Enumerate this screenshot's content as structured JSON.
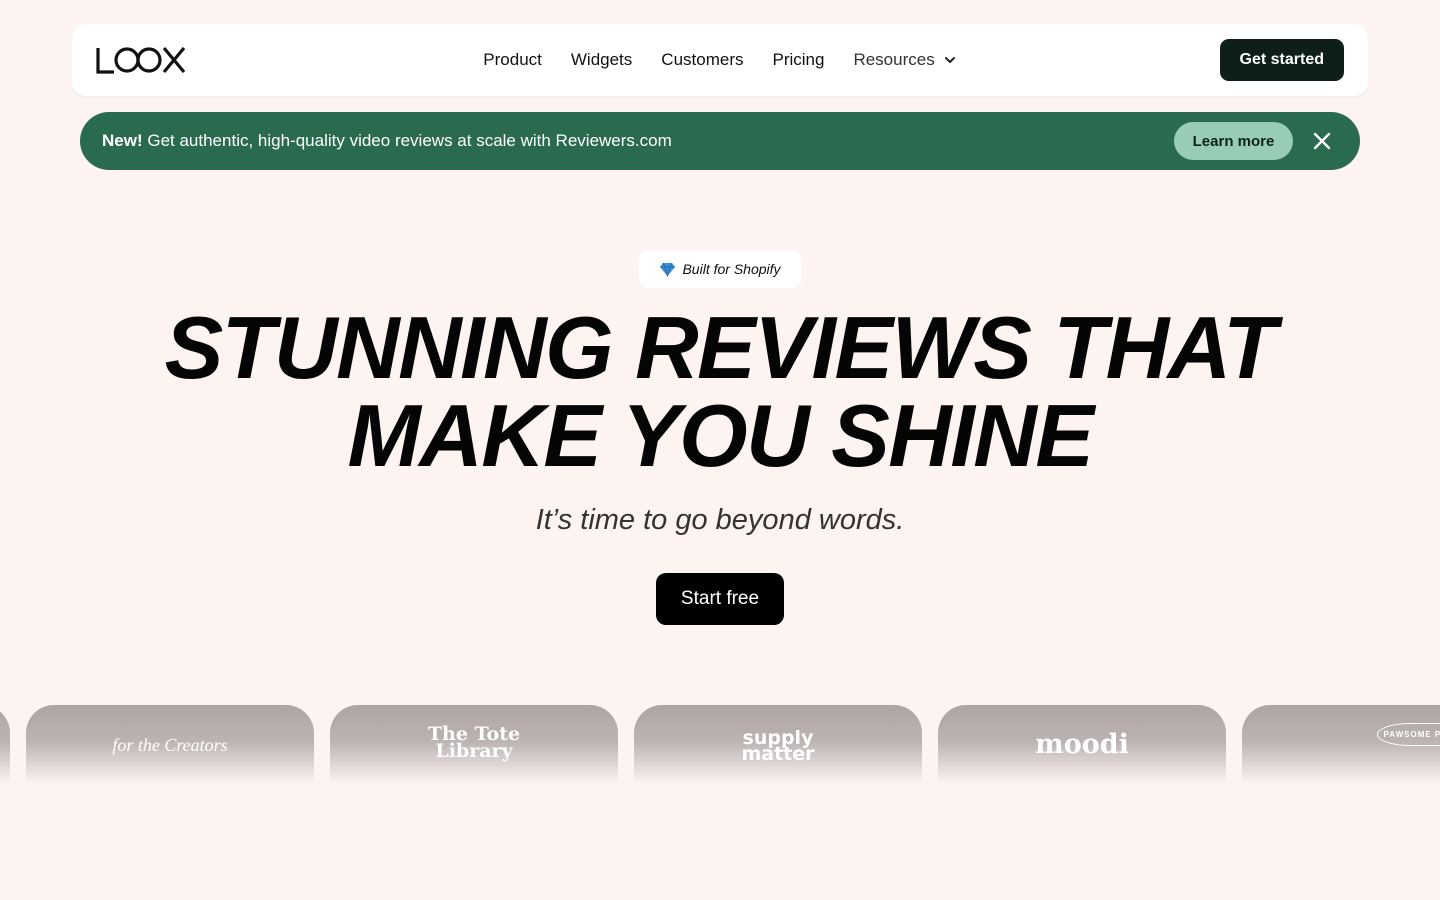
{
  "nav": {
    "logo": "LOOX",
    "links": [
      "Product",
      "Widgets",
      "Customers",
      "Pricing",
      "Resources"
    ],
    "cta": "Get started"
  },
  "banner": {
    "new_label": "New!",
    "text": " Get authentic, high-quality video reviews at scale with Reviewers.com",
    "button": "Learn more"
  },
  "hero": {
    "badge": "Built for Shopify",
    "headline_line1": "STUNNING REVIEWS THAT",
    "headline_line2": "MAKE YOU SHINE",
    "subtitle": "It’s time to go beyond words.",
    "cta": "Start free"
  },
  "brands": {
    "for_the_creators": "for the Creators",
    "tote_library_1": "The Tote",
    "tote_library_2": "Library",
    "supply_matter_1": "supply",
    "supply_matter_2": "matter",
    "moodi": "moodi",
    "pawsome": "PAWSOME PAW BOUTIQUE"
  },
  "colors": {
    "background": "#fdf4f1",
    "banner": "#2a6b50",
    "learn_more_bg": "#98cdb5",
    "dark_cta": "#0d1f17"
  }
}
